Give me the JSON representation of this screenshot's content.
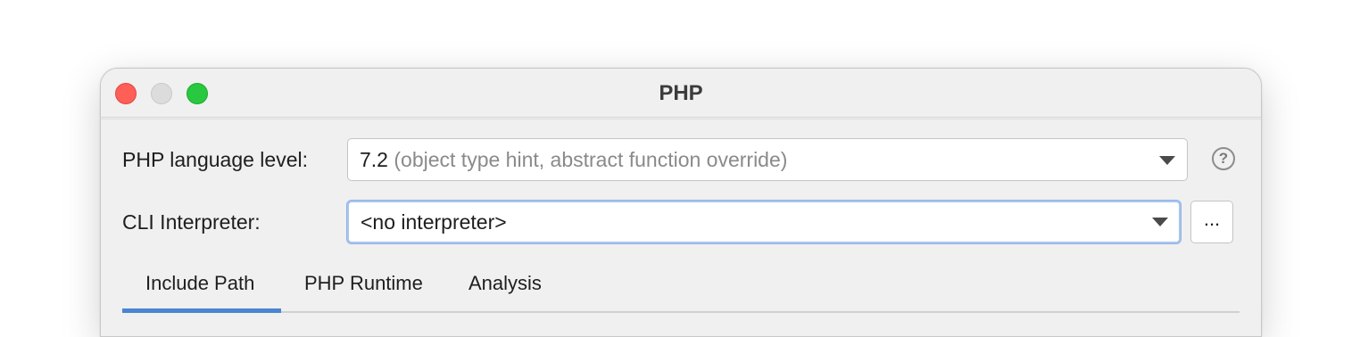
{
  "window": {
    "title": "PHP"
  },
  "form": {
    "language_level_label": "PHP language level:",
    "language_level_value": "7.2",
    "language_level_hint": "(object type hint, abstract function override)",
    "cli_label": "CLI Interpreter:",
    "cli_value": "<no interpreter>",
    "browse_label": "...",
    "help_label": "?"
  },
  "tabs": [
    {
      "label": "Include Path",
      "selected": true
    },
    {
      "label": "PHP Runtime",
      "selected": false
    },
    {
      "label": "Analysis",
      "selected": false
    }
  ],
  "colors": {
    "accent": "#4a85d0",
    "close": "#fe5f57",
    "minimize": "#dcdcdc",
    "maximize": "#28c840"
  }
}
